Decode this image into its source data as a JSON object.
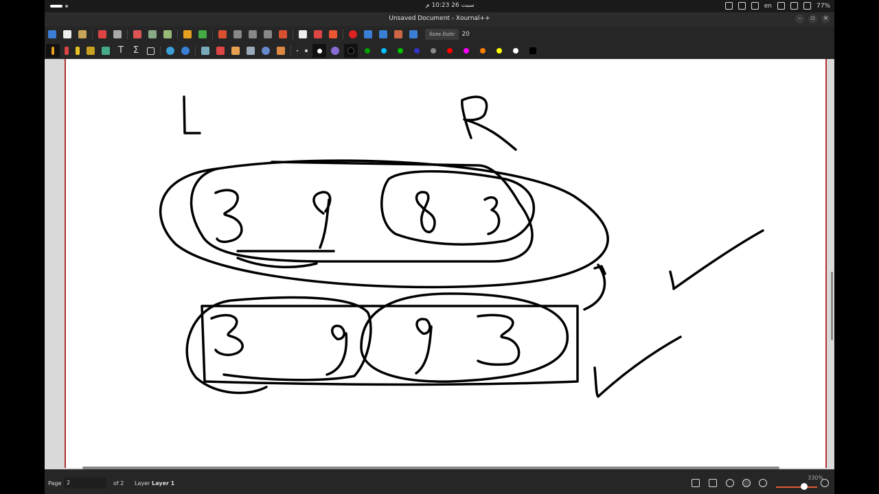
{
  "topbar": {
    "clock": "سبت 26 10:23 م",
    "lang": "en",
    "battery": "77%"
  },
  "window": {
    "title": "Unsaved Document - Xournal++"
  },
  "toolbar": {
    "font_name": "Sans Italic",
    "font_size": "20"
  },
  "colors": {
    "palette": [
      "#000000",
      "#00a000",
      "#00c0ff",
      "#00c000",
      "#3333cc",
      "#888888",
      "#ff0000",
      "#ff00ff",
      "#ff8000",
      "#ffff00",
      "#ffffff",
      "#000000"
    ],
    "accent": "#e05a3a"
  },
  "page_labels": {
    "left": "L",
    "right": "R"
  },
  "status": {
    "page_label": "Page",
    "page_value": "2",
    "of_label": "of 2",
    "layer_label": "Layer",
    "layer_value": "Layer 1",
    "zoom": "330%"
  }
}
